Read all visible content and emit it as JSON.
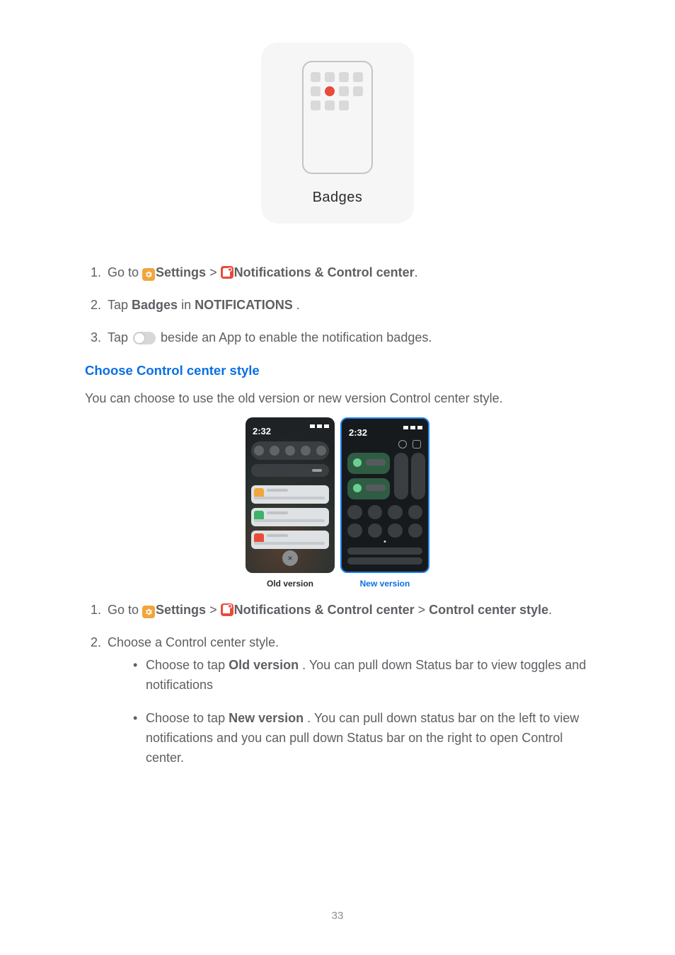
{
  "figure1": {
    "caption": "Badges"
  },
  "listA": {
    "step1_a": "Go to ",
    "step1_settings": "Settings",
    "step1_sep": " > ",
    "step1_notif": "Notifications & Control center",
    "step1_b": ".",
    "step2_a": "Tap ",
    "step2_badges": "Badges",
    "step2_b": " in ",
    "step2_section": "NOTIFICATIONS",
    "step2_c": ".",
    "step3_a": "Tap ",
    "step3_b": " beside an App to enable the notification badges."
  },
  "heading": "Choose Control center style",
  "intro": "You can choose to use the old version or new version Control center style.",
  "figure2": {
    "time": "2:32",
    "old_caption": "Old version",
    "new_caption": "New version",
    "close_glyph": "×"
  },
  "listB": {
    "step1_a": "Go to ",
    "step1_settings": "Settings",
    "step1_sep1": " > ",
    "step1_notif": "Notifications & Control center",
    "step1_sep2": " > ",
    "step1_ccs": "Control center style",
    "step1_b": ".",
    "step2": "Choose a Control center style.",
    "b1_a": "Choose to tap ",
    "b1_bold": "Old version",
    "b1_b": ". You can pull down Status bar to view toggles and notifications",
    "b2_a": "Choose to tap ",
    "b2_bold": "New version",
    "b2_b": ". You can pull down status bar on the left to view notifications and you can pull down Status bar on the right to open Control center."
  },
  "page_number": "33"
}
